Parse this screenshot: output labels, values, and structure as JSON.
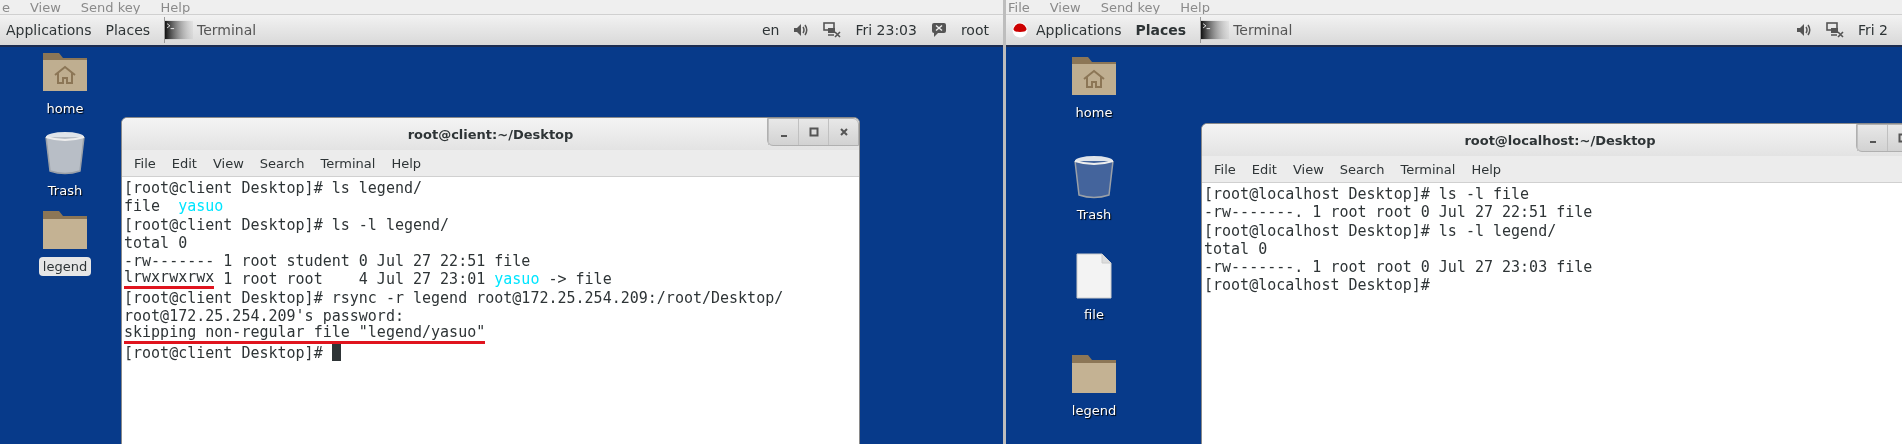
{
  "screens": [
    {
      "viewer_menu": [
        "e",
        "View",
        "Send key",
        "Help"
      ],
      "panel": {
        "logo": false,
        "menus": [
          {
            "label": "Applications",
            "selected": false
          },
          {
            "label": "Places",
            "selected": false
          }
        ],
        "task": "Terminal",
        "status": [
          {
            "kind": "text",
            "text": "en"
          },
          {
            "kind": "volume"
          },
          {
            "kind": "network"
          },
          {
            "kind": "text",
            "text": "Fri 23:03"
          },
          {
            "kind": "user"
          },
          {
            "kind": "text",
            "text": "root"
          }
        ]
      },
      "desktop_icons": [
        {
          "kind": "home",
          "label": "home",
          "selected": false
        },
        {
          "kind": "trash",
          "label": "Trash",
          "selected": false
        },
        {
          "kind": "folder",
          "label": "legend",
          "selected": true
        }
      ],
      "terminal": {
        "title": "root@client:~/Desktop",
        "window_buttons": [
          {
            "kind": "minimize"
          },
          {
            "kind": "maximize"
          },
          {
            "kind": "close"
          }
        ],
        "menu": [
          "File",
          "Edit",
          "View",
          "Search",
          "Terminal",
          "Help"
        ],
        "cursor": true,
        "lines": [
          [
            {
              "text": "[root@client Desktop]# ls legend/",
              "color": "#2e3436",
              "underlined": false
            }
          ],
          [
            {
              "text": "file  ",
              "color": "#2e3436",
              "underlined": false
            },
            {
              "text": "yasuo",
              "color": "#00e5ff",
              "underlined": false
            }
          ],
          [
            {
              "text": "[root@client Desktop]# ls -l legend/",
              "color": "#2e3436",
              "underlined": false
            }
          ],
          [
            {
              "text": "total 0",
              "color": "#2e3436",
              "underlined": false
            }
          ],
          [
            {
              "text": "-rw------- 1 root student 0 Jul 27 22:51 file",
              "color": "#2e3436",
              "underlined": false
            }
          ],
          [
            {
              "text": "lrwxrwxrwx",
              "color": "#2e3436",
              "underlined": true
            },
            {
              "text": " 1 root root    4 Jul 27 23:01 ",
              "color": "#2e3436",
              "underlined": false
            },
            {
              "text": "yasuo",
              "color": "#00e5ff",
              "underlined": false
            },
            {
              "text": " -> file",
              "color": "#2e3436",
              "underlined": false
            }
          ],
          [
            {
              "text": "[root@client Desktop]# rsync -r legend root@172.25.254.209:/root/Desktop/",
              "color": "#2e3436",
              "underlined": false
            }
          ],
          [
            {
              "text": "root@172.25.254.209's password:",
              "color": "#2e3436",
              "underlined": false
            }
          ],
          [
            {
              "text": "skipping non-regular file \"legend/yasuo\"",
              "color": "#2e3436",
              "underlined": true
            }
          ],
          [
            {
              "text": "[root@client Desktop]# ",
              "color": "#2e3436",
              "underlined": false
            }
          ]
        ]
      }
    },
    {
      "viewer_menu": [
        "File",
        "View",
        "Send key",
        "Help"
      ],
      "panel": {
        "logo": true,
        "menus": [
          {
            "label": "Applications",
            "selected": false
          },
          {
            "label": "Places",
            "selected": true
          }
        ],
        "task": "Terminal",
        "status": [
          {
            "kind": "volume"
          },
          {
            "kind": "network"
          },
          {
            "kind": "text",
            "text": "Fri 2"
          }
        ]
      },
      "desktop_icons": [
        {
          "kind": "home",
          "label": "home",
          "selected": false
        },
        {
          "kind": "trash",
          "label": "Trash",
          "selected": false
        },
        {
          "kind": "file",
          "label": "file",
          "selected": false
        },
        {
          "kind": "folder",
          "label": "legend",
          "selected": false
        }
      ],
      "terminal": {
        "title": "root@localhost:~/Desktop",
        "window_buttons": [
          {
            "kind": "minimize"
          },
          {
            "kind": "maximize"
          }
        ],
        "menu": [
          "File",
          "Edit",
          "View",
          "Search",
          "Terminal",
          "Help"
        ],
        "cursor": false,
        "lines": [
          [
            {
              "text": "[root@localhost Desktop]# ls -l file",
              "color": "#2e3436",
              "underlined": false
            }
          ],
          [
            {
              "text": "-rw-------. 1 root root 0 Jul 27 22:51 file",
              "color": "#2e3436",
              "underlined": false
            }
          ],
          [
            {
              "text": "[root@localhost Desktop]# ls -l legend/",
              "color": "#2e3436",
              "underlined": false
            }
          ],
          [
            {
              "text": "total 0",
              "color": "#2e3436",
              "underlined": false
            }
          ],
          [
            {
              "text": "-rw-------. 1 root root 0 Jul 27 23:03 file",
              "color": "#2e3436",
              "underlined": false
            }
          ],
          [
            {
              "text": "[root@localhost Desktop]#",
              "color": "#2e3436",
              "underlined": false
            }
          ]
        ]
      }
    }
  ]
}
